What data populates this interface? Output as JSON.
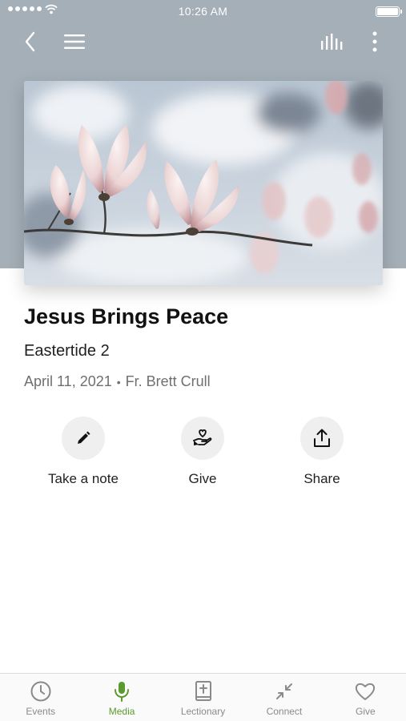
{
  "status_bar": {
    "time": "10:26 AM"
  },
  "nav": {
    "back_icon": "chevron-left-icon",
    "menu_icon": "hamburger-icon",
    "audio_icon": "audio-bars-icon",
    "more_icon": "more-vertical-icon"
  },
  "hero_image": {
    "subject": "magnolia-blossoms"
  },
  "sermon": {
    "title": "Jesus Brings Peace",
    "series": "Eastertide 2",
    "date": "April 11, 2021",
    "separator": "•",
    "speaker": "Fr. Brett Crull"
  },
  "actions": [
    {
      "label": "Take a note",
      "icon": "pencil-icon"
    },
    {
      "label": "Give",
      "icon": "hand-heart-icon"
    },
    {
      "label": "Share",
      "icon": "share-icon"
    }
  ],
  "tabs": [
    {
      "label": "Events",
      "icon": "clock-icon",
      "active": false
    },
    {
      "label": "Media",
      "icon": "microphone-icon",
      "active": true
    },
    {
      "label": "Lectionary",
      "icon": "bible-icon",
      "active": false
    },
    {
      "label": "Connect",
      "icon": "connect-arrows-icon",
      "active": false
    },
    {
      "label": "Give",
      "icon": "heart-icon",
      "active": false
    }
  ],
  "colors": {
    "header_background": "#a5afb8",
    "active_tab": "#5a9a2e",
    "inactive_tab": "#8a8a8a",
    "action_circle": "#efefef"
  }
}
